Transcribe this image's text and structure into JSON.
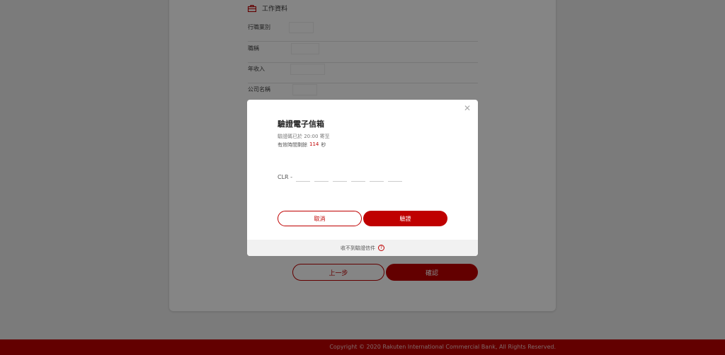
{
  "section": {
    "title": "工作資料",
    "icon": "briefcase-icon"
  },
  "form_rows": [
    {
      "label": "行職業別"
    },
    {
      "label": "職稱"
    },
    {
      "label": "年收入"
    },
    {
      "label": "公司名稱"
    }
  ],
  "page_buttons": {
    "prev": "上一步",
    "confirm": "確認"
  },
  "footer": {
    "copyright": "Copyright © 2020 Rakuten International Commercial Bank, All Rights Reserved."
  },
  "modal": {
    "title": "驗證電子信箱",
    "sent_text": "驗證碼已於 20:00 寄至",
    "remaining_prefix": "有效時間剩餘",
    "remaining_seconds": "114",
    "remaining_unit": "秒",
    "otp_prefix": "CLR -",
    "otp_digits": [
      "",
      "",
      "",
      "",
      "",
      ""
    ],
    "cancel": "取消",
    "verify": "驗證",
    "help_text": "收不到驗證信件",
    "help_icon": "question-circle-icon",
    "close_icon": "close-icon"
  },
  "colors": {
    "brand": "#bf0000"
  }
}
